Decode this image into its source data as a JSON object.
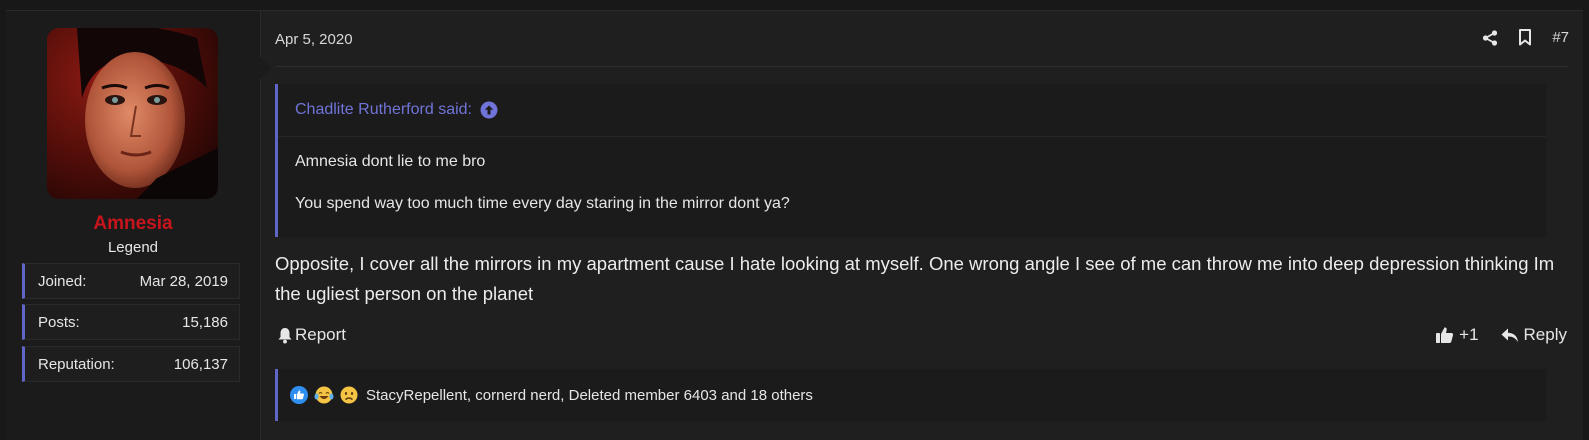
{
  "user": {
    "name": "Amnesia",
    "title": "Legend",
    "name_color": "#c8141c",
    "stats": [
      {
        "label": "Joined:",
        "value": "Mar 28, 2019"
      },
      {
        "label": "Posts:",
        "value": "15,186"
      },
      {
        "label": "Reputation:",
        "value": "106,137"
      }
    ]
  },
  "post": {
    "date": "Apr 5, 2020",
    "number": "#7",
    "quote": {
      "author_line": "Chadlite Rutherford said:",
      "lines": [
        "Amnesia dont lie to me bro",
        "You spend way too much time every day staring in the mirror dont ya?"
      ]
    },
    "message": "Opposite, I cover all the mirrors in my apartment cause I hate looking at myself. One wrong angle I see of me can throw me into deep depression thinking Im the ugliest person on the planet",
    "actions": {
      "report": "Report",
      "plus_one": "+1",
      "reply": "Reply"
    },
    "reactions": {
      "icons": [
        "like-reaction-icon",
        "laugh-cry-reaction-icon",
        "sad-reaction-icon"
      ],
      "names": "StacyRepellent, cornerd nerd, Deleted member 6403 and 18 others"
    }
  },
  "colors": {
    "accent": "#5f66c8",
    "quote_link": "#7074d8"
  }
}
